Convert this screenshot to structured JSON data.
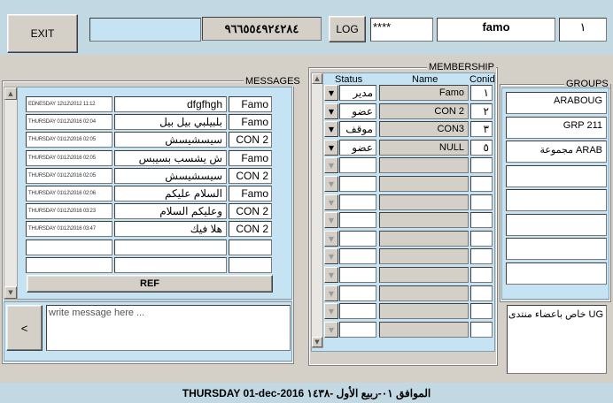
{
  "toolbar": {
    "exit_label": "EXIT",
    "status_field": "",
    "phone": "٩٦٦٥٥٤٩٢٤٢٨٤",
    "log_label": "LOG",
    "password": "****",
    "username": "famo",
    "user_number": "١"
  },
  "messages": {
    "title": "MESSAGES",
    "rows": [
      {
        "date": "EDNESDAY 12\\12\\2012 11:12",
        "text": "dfgfhgh",
        "user": "Famo"
      },
      {
        "date": "THURSDAY 01\\12\\2016 02:04",
        "text": "بلبيلبي بيل بيل",
        "user": "Famo"
      },
      {
        "date": "THURSDAY 01\\12\\2016 02:05",
        "text": "سيسشيسش",
        "user": "CON 2"
      },
      {
        "date": "THURSDAY 01\\12\\2016 02:05",
        "text": "ش يشسب بسيبس",
        "user": "Famo"
      },
      {
        "date": "THURSDAY 01\\12\\2016 02:05",
        "text": "سيسشيسش",
        "user": "CON 2"
      },
      {
        "date": "THURSDAY 01\\12\\2016 02:06",
        "text": "السلام عليكم",
        "user": "Famo"
      },
      {
        "date": "THURSDAY 01\\12\\2016 03:23",
        "text": "وعليكم السلام",
        "user": "CON 2"
      },
      {
        "date": "THURSDAY 01\\12\\2016 03:47",
        "text": "هلا فيك",
        "user": "CON 2"
      },
      {
        "date": "",
        "text": "",
        "user": ""
      },
      {
        "date": "",
        "text": "",
        "user": ""
      }
    ],
    "ref_label": "REF",
    "input_placeholder": "write message here ...",
    "send_label": "<"
  },
  "membership": {
    "title": "MEMBERSHIP",
    "headers": {
      "status": "Status",
      "name": "Name",
      "conid": "Conid"
    },
    "rows": [
      {
        "status": "مدير",
        "name": "Famo",
        "conid": "١"
      },
      {
        "status": "عضو",
        "name": "CON 2",
        "conid": "٢"
      },
      {
        "status": "موقف",
        "name": "CON3",
        "conid": "٣"
      },
      {
        "status": "عضو",
        "name": "NULL",
        "conid": "٥"
      },
      {
        "status": "",
        "name": "",
        "conid": ""
      },
      {
        "status": "",
        "name": "",
        "conid": ""
      },
      {
        "status": "",
        "name": "",
        "conid": ""
      },
      {
        "status": "",
        "name": "",
        "conid": ""
      },
      {
        "status": "",
        "name": "",
        "conid": ""
      },
      {
        "status": "",
        "name": "",
        "conid": ""
      },
      {
        "status": "",
        "name": "",
        "conid": ""
      },
      {
        "status": "",
        "name": "",
        "conid": ""
      },
      {
        "status": "",
        "name": "",
        "conid": ""
      },
      {
        "status": "",
        "name": "",
        "conid": ""
      }
    ]
  },
  "groups": {
    "title": "GROUPS",
    "items": [
      "ARABOUG",
      "GRP 211",
      "مجموعة ARAB",
      "",
      "",
      "",
      "",
      ""
    ],
    "description": "خاص باعضاء منتدى UG"
  },
  "statusbar": {
    "text": "THURSDAY  01-dec-2016  الموافق  ٠١-ربيع الأول  -١٤٣٨"
  }
}
